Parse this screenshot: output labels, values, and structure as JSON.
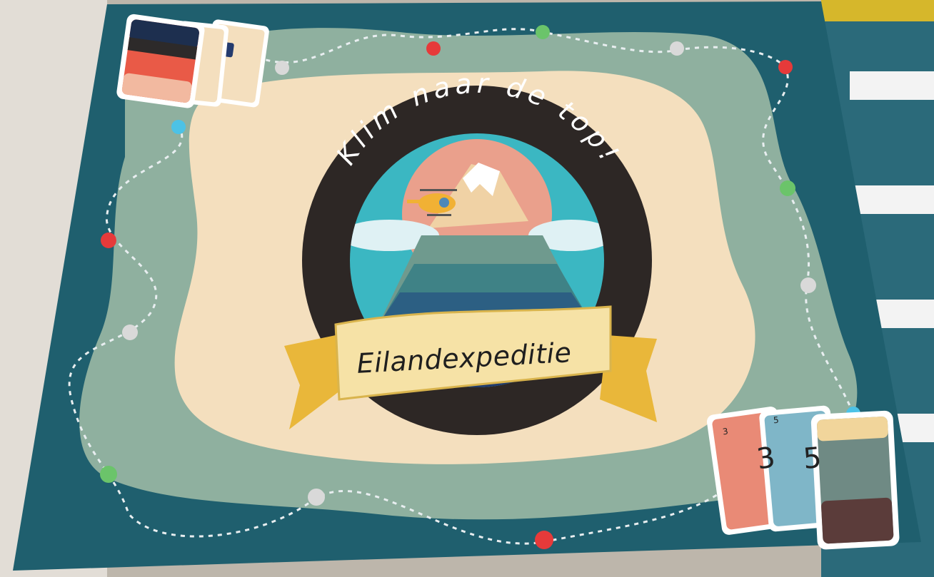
{
  "board": {
    "title_arc": "Klim naar de top!",
    "banner": "Eilandexpeditie"
  },
  "cards_bottom_right": [
    {
      "number": "3"
    },
    {
      "number": "5"
    }
  ],
  "colors": {
    "box_teal": "#1f5f6e",
    "path_green": "#8fb09f",
    "sand": "#f4dfbe",
    "ring_dark": "#2d2725",
    "ribbon_gold": "#e9b73a",
    "dot_red": "#e63a3a",
    "dot_green": "#6bc46a",
    "dot_white": "#d9d9d9",
    "dot_blue": "#4cc2e6"
  }
}
